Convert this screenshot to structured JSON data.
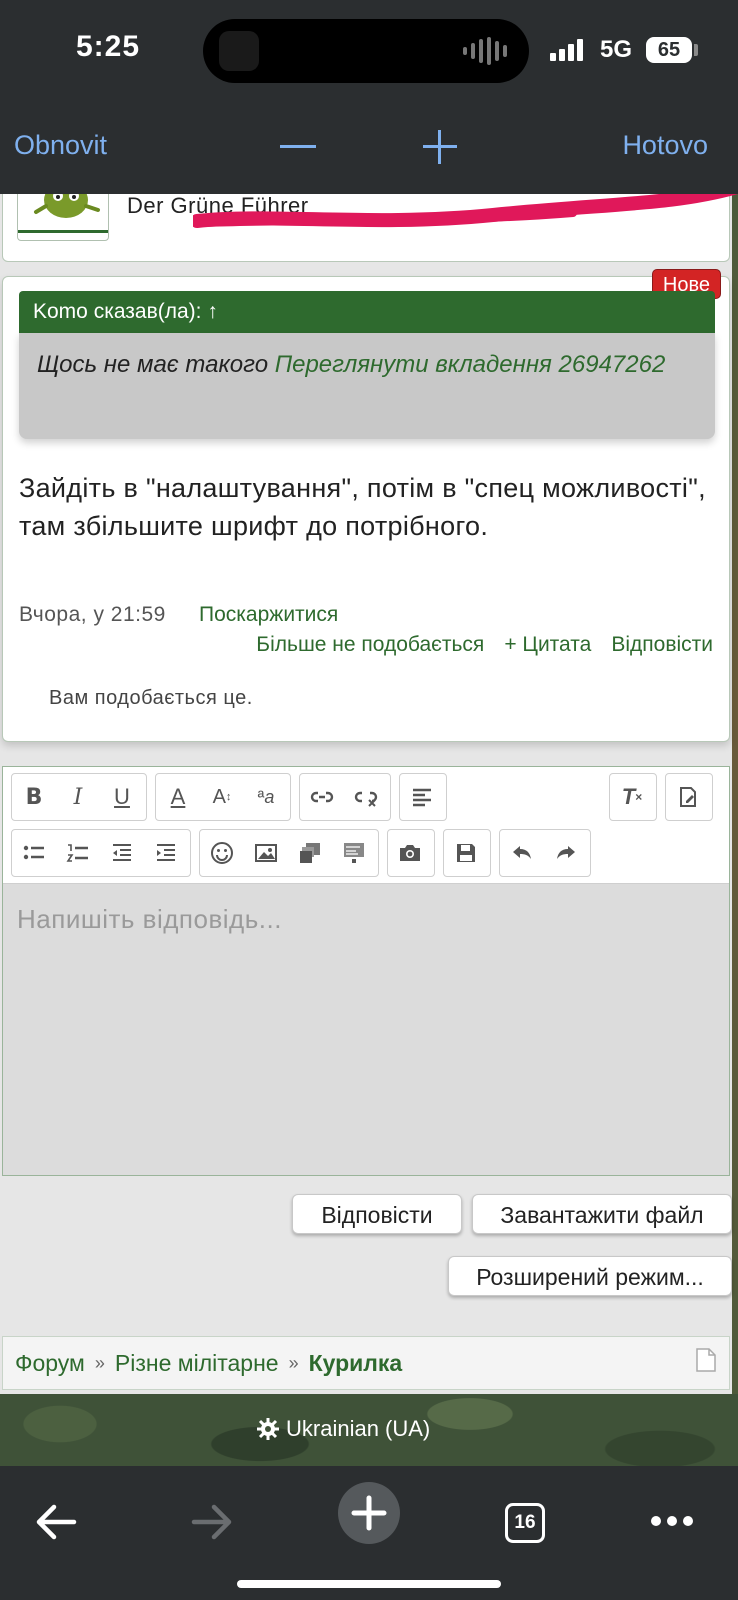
{
  "status_bar": {
    "time": "5:25",
    "network": "5G",
    "battery": "65"
  },
  "zoom_toolbar": {
    "refresh_label": "Obnovit",
    "done_label": "Hotovo"
  },
  "signature": {
    "name": "Der Grüne Führer"
  },
  "post": {
    "new_badge": "Нове",
    "quote_header": "Komo сказав(ла): ↑",
    "quote_text": "Щось не має такого ",
    "quote_link": "Переглянути вкладення 26947262",
    "body": "Зайдіть в \"налаштування\", потім в \"спец можливості\", там збільшите шрифт до потрібного.",
    "timestamp": "Вчора, у 21:59",
    "report_label": "Поскаржитися",
    "unlike_label": "Більше не подобається",
    "quote_label": "+ Цитата",
    "reply_label": "Відповісти",
    "likes_text": "Вам подобається це."
  },
  "editor": {
    "placeholder": "Напишіть відповідь..."
  },
  "form": {
    "reply_button": "Відповісти",
    "upload_button": "Завантажити файл",
    "advanced_button": "Розширений режим..."
  },
  "breadcrumb": {
    "items": [
      "Форум",
      "Різне мілітарне",
      "Курилка"
    ],
    "separator": "»"
  },
  "footer": {
    "language": "Ukrainian (UA)"
  },
  "bottom_nav": {
    "tab_count": "16"
  },
  "colors": {
    "accent_green": "#2e6a2e",
    "ios_blue": "#7fb0ee",
    "badge_red": "#d32424",
    "scribble_pink": "#e0185a"
  }
}
